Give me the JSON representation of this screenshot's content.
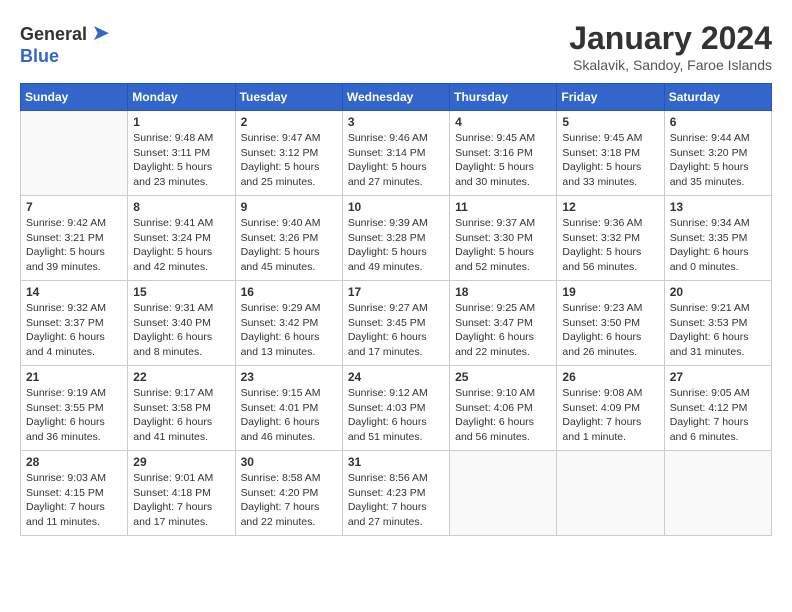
{
  "logo": {
    "general": "General",
    "blue": "Blue"
  },
  "title": "January 2024",
  "location": "Skalavik, Sandoy, Faroe Islands",
  "weekdays": [
    "Sunday",
    "Monday",
    "Tuesday",
    "Wednesday",
    "Thursday",
    "Friday",
    "Saturday"
  ],
  "weeks": [
    [
      {
        "day": "",
        "info": ""
      },
      {
        "day": "1",
        "info": "Sunrise: 9:48 AM\nSunset: 3:11 PM\nDaylight: 5 hours\nand 23 minutes."
      },
      {
        "day": "2",
        "info": "Sunrise: 9:47 AM\nSunset: 3:12 PM\nDaylight: 5 hours\nand 25 minutes."
      },
      {
        "day": "3",
        "info": "Sunrise: 9:46 AM\nSunset: 3:14 PM\nDaylight: 5 hours\nand 27 minutes."
      },
      {
        "day": "4",
        "info": "Sunrise: 9:45 AM\nSunset: 3:16 PM\nDaylight: 5 hours\nand 30 minutes."
      },
      {
        "day": "5",
        "info": "Sunrise: 9:45 AM\nSunset: 3:18 PM\nDaylight: 5 hours\nand 33 minutes."
      },
      {
        "day": "6",
        "info": "Sunrise: 9:44 AM\nSunset: 3:20 PM\nDaylight: 5 hours\nand 35 minutes."
      }
    ],
    [
      {
        "day": "7",
        "info": "Sunrise: 9:42 AM\nSunset: 3:21 PM\nDaylight: 5 hours\nand 39 minutes."
      },
      {
        "day": "8",
        "info": "Sunrise: 9:41 AM\nSunset: 3:24 PM\nDaylight: 5 hours\nand 42 minutes."
      },
      {
        "day": "9",
        "info": "Sunrise: 9:40 AM\nSunset: 3:26 PM\nDaylight: 5 hours\nand 45 minutes."
      },
      {
        "day": "10",
        "info": "Sunrise: 9:39 AM\nSunset: 3:28 PM\nDaylight: 5 hours\nand 49 minutes."
      },
      {
        "day": "11",
        "info": "Sunrise: 9:37 AM\nSunset: 3:30 PM\nDaylight: 5 hours\nand 52 minutes."
      },
      {
        "day": "12",
        "info": "Sunrise: 9:36 AM\nSunset: 3:32 PM\nDaylight: 5 hours\nand 56 minutes."
      },
      {
        "day": "13",
        "info": "Sunrise: 9:34 AM\nSunset: 3:35 PM\nDaylight: 6 hours\nand 0 minutes."
      }
    ],
    [
      {
        "day": "14",
        "info": "Sunrise: 9:32 AM\nSunset: 3:37 PM\nDaylight: 6 hours\nand 4 minutes."
      },
      {
        "day": "15",
        "info": "Sunrise: 9:31 AM\nSunset: 3:40 PM\nDaylight: 6 hours\nand 8 minutes."
      },
      {
        "day": "16",
        "info": "Sunrise: 9:29 AM\nSunset: 3:42 PM\nDaylight: 6 hours\nand 13 minutes."
      },
      {
        "day": "17",
        "info": "Sunrise: 9:27 AM\nSunset: 3:45 PM\nDaylight: 6 hours\nand 17 minutes."
      },
      {
        "day": "18",
        "info": "Sunrise: 9:25 AM\nSunset: 3:47 PM\nDaylight: 6 hours\nand 22 minutes."
      },
      {
        "day": "19",
        "info": "Sunrise: 9:23 AM\nSunset: 3:50 PM\nDaylight: 6 hours\nand 26 minutes."
      },
      {
        "day": "20",
        "info": "Sunrise: 9:21 AM\nSunset: 3:53 PM\nDaylight: 6 hours\nand 31 minutes."
      }
    ],
    [
      {
        "day": "21",
        "info": "Sunrise: 9:19 AM\nSunset: 3:55 PM\nDaylight: 6 hours\nand 36 minutes."
      },
      {
        "day": "22",
        "info": "Sunrise: 9:17 AM\nSunset: 3:58 PM\nDaylight: 6 hours\nand 41 minutes."
      },
      {
        "day": "23",
        "info": "Sunrise: 9:15 AM\nSunset: 4:01 PM\nDaylight: 6 hours\nand 46 minutes."
      },
      {
        "day": "24",
        "info": "Sunrise: 9:12 AM\nSunset: 4:03 PM\nDaylight: 6 hours\nand 51 minutes."
      },
      {
        "day": "25",
        "info": "Sunrise: 9:10 AM\nSunset: 4:06 PM\nDaylight: 6 hours\nand 56 minutes."
      },
      {
        "day": "26",
        "info": "Sunrise: 9:08 AM\nSunset: 4:09 PM\nDaylight: 7 hours\nand 1 minute."
      },
      {
        "day": "27",
        "info": "Sunrise: 9:05 AM\nSunset: 4:12 PM\nDaylight: 7 hours\nand 6 minutes."
      }
    ],
    [
      {
        "day": "28",
        "info": "Sunrise: 9:03 AM\nSunset: 4:15 PM\nDaylight: 7 hours\nand 11 minutes."
      },
      {
        "day": "29",
        "info": "Sunrise: 9:01 AM\nSunset: 4:18 PM\nDaylight: 7 hours\nand 17 minutes."
      },
      {
        "day": "30",
        "info": "Sunrise: 8:58 AM\nSunset: 4:20 PM\nDaylight: 7 hours\nand 22 minutes."
      },
      {
        "day": "31",
        "info": "Sunrise: 8:56 AM\nSunset: 4:23 PM\nDaylight: 7 hours\nand 27 minutes."
      },
      {
        "day": "",
        "info": ""
      },
      {
        "day": "",
        "info": ""
      },
      {
        "day": "",
        "info": ""
      }
    ]
  ]
}
